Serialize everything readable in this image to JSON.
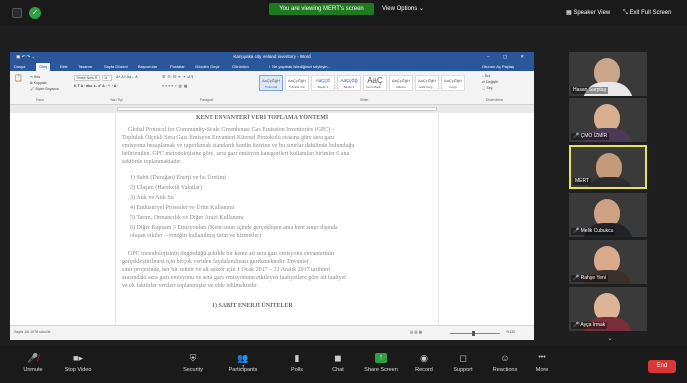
{
  "top": {
    "viewing_banner": "You are viewing MERT's screen",
    "view_options": "View Options ⌄",
    "speaker_view": "Speaker View",
    "exit_full_screen": "Exit Full Screen"
  },
  "word": {
    "title": "Karşıyaka city ıreland inventory - Word",
    "window_controls": "– ▢ ✕",
    "tabs": [
      "Dosya",
      "Giriş",
      "Ekle",
      "Tasarım",
      "Sayfa Düzeni",
      "Başvurular",
      "Postalar",
      "Gözden Geçir",
      "Görünüm"
    ],
    "tell_me": "Ne yapmak istediğinizi söyleyin...",
    "share": "Oturum Aç  Paylaş",
    "font_name": "Times New R",
    "font_size": "11",
    "styles": [
      {
        "preview": "AaÇçĞğH",
        "name": "¶ Normal"
      },
      {
        "preview": "AaÇçĞğH",
        "name": "¶ Aralık Yok"
      },
      {
        "preview": "AaÇçĞ",
        "name": "Başlık 1"
      },
      {
        "preview": "AaÇçĞğ",
        "name": "Başlık 2"
      },
      {
        "preview": "AaÇ",
        "name": "Konu Başlı..."
      },
      {
        "preview": "AaÇçĞğH",
        "name": "Altkonu"
      },
      {
        "preview": "AaÇçĞğH",
        "name": "Hafif Vurg..."
      },
      {
        "preview": "AaÇçĞğH",
        "name": "Vurgu"
      }
    ],
    "groups": [
      "Pano",
      "Yazı Tipi",
      "Paragraf",
      "Stiller",
      "Düzenleme"
    ],
    "edit": [
      "Bul",
      "Değiştir",
      "Seç"
    ],
    "status_left": "Sayfa 1/6   1078 sözcük",
    "status_zoom": "%130",
    "doc": {
      "heading": "KENT ENVANTERİ VERİ TOPLAMA YÖNTEMİ",
      "para1": [
        "Global Protocol for Community-Scale Greenhouse Gas Emission Inventories (GPC) –",
        "Topluluk Ölçekli Sera Gazı Emisyon Envanteri Küresel Protokolü esasına göre sera gazı",
        "emisyonu hesaplamak ve raporlamak standardı kentin üzerine ve bu sınırlar dahilinde bulunduğu",
        "belirlenilen. GPC metodolojisine göre, sera gazı emisyon kategorileri kullanılan birimler 6 ana",
        "sektörde toplanmaktadır:"
      ],
      "list": [
        "1)   Sabit (Durağan) Enerji ve Isı Üretimi",
        "2)   Ulaşım (Hareketli Yakıtlar)",
        "3)   Atık ve Atık Su",
        "4)   Endüstriyel Prosesler ve Ürün Kullanımı",
        "5)   Tarım, Ormancılık ve Diğer Arazi Kullanımı",
        "6)   Diğer Kapsam 3 Emisyonları (Kent sınırı içinde gerçekleşen ama kent sınırı dışında",
        "       oluşan etkiler – örneğin kullanılmış ürün ve hizmetler)"
      ],
      "para2": [
        "GPC metodolojisinin öngördüğü şekilde bir kente ait sera gazı emisyonu envanterinin",
        "gerçekleştirilmesi için birçok veriden faydalanılması gerekmektedir. Envanter",
        "sınır projesinde, her bir sektör ve alt sektör için 1 Ocak 2017 – 31 Aralık 2017 tarihleri",
        "arasındaki sera gazı emisyonu ve sera gazı emisyonunu etkileyen faaliyetlere göre ait faaliyet",
        "ve ek faktörler verileri toplanmıştır ve elde edilmektedir."
      ],
      "section": "1)  SABİT ENERJİ ÜNİTELER"
    }
  },
  "participants": [
    {
      "name": "Hasan Sarptaş",
      "muted": false,
      "bg": "#2d2a28",
      "skin": "#c9a58a",
      "shirt": "#e8e8e8"
    },
    {
      "name": "ÇMO İZMİR",
      "muted": true,
      "bg": "#6b5a48",
      "skin": "#d8b08f",
      "shirt": "#4a3a55"
    },
    {
      "name": "MERT",
      "muted": false,
      "bg": "#5a5650",
      "skin": "#c49a7a",
      "shirt": "#2c2c2c"
    },
    {
      "name": "Melik Cubukcu",
      "muted": true,
      "bg": "#8a8478",
      "skin": "#cfa283",
      "shirt": "#20242a"
    },
    {
      "name": "Rahşe Yeni",
      "muted": true,
      "bg": "#b4aea5",
      "skin": "#d7ab8c",
      "shirt": "#3a302c"
    },
    {
      "name": "Ayça Irmak",
      "muted": true,
      "bg": "#6d6358",
      "skin": "#ddb496",
      "shirt": "#7a2d3a"
    }
  ],
  "toolbar": {
    "items": [
      {
        "label": "Unmute",
        "icon": "🎤"
      },
      {
        "label": "Stop Video",
        "icon": "■"
      },
      {
        "label": "Security",
        "icon": "⛨"
      },
      {
        "label": "Participants",
        "icon": "👥"
      },
      {
        "label": "Polls",
        "icon": "▮"
      },
      {
        "label": "Chat",
        "icon": "◼"
      },
      {
        "label": "Share Screen",
        "icon": "↑"
      },
      {
        "label": "Record",
        "icon": "◉"
      },
      {
        "label": "Support",
        "icon": "◻"
      },
      {
        "label": "Reactions",
        "icon": "☺"
      },
      {
        "label": "More",
        "icon": "•••"
      }
    ],
    "participants_count": "7",
    "end": "End"
  },
  "colors": {
    "word_blue": "#2b579a",
    "share_green": "#2ea043",
    "end_red": "#d93737",
    "active_speaker": "#e8e15a"
  }
}
